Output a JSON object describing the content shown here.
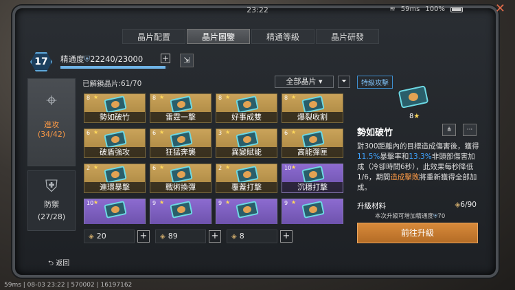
{
  "status": {
    "time": "23:22",
    "ping": "59ms",
    "battery": "100%"
  },
  "tabs": [
    {
      "label": "晶片配置",
      "active": false
    },
    {
      "label": "晶片圖鑒",
      "active": true
    },
    {
      "label": "精通等級",
      "active": false
    },
    {
      "label": "晶片研發",
      "active": false
    }
  ],
  "mastery": {
    "level": "17",
    "label": "精通度",
    "value": "22240/23000",
    "progress": 0.967
  },
  "sidebar": [
    {
      "label": "進攻",
      "count": "(34/42)"
    },
    {
      "label": "防禦",
      "count": "(27/28)"
    }
  ],
  "list": {
    "unlocked": "已解鎖晶片:61/70",
    "filter": "全部晶片"
  },
  "cards": [
    {
      "name": "勢如破竹",
      "count": "8",
      "star": "★",
      "color": "gold"
    },
    {
      "name": "雷霆一擊",
      "count": "8",
      "star": "★",
      "color": "gold"
    },
    {
      "name": "好事成雙",
      "count": "8",
      "star": "★",
      "color": "gold"
    },
    {
      "name": "爆裂收割",
      "count": "8",
      "star": "★",
      "color": "gold"
    },
    {
      "name": "破盾強攻",
      "count": "6",
      "star": "★",
      "color": "gold"
    },
    {
      "name": "狂猛奔襲",
      "count": "6",
      "star": "★",
      "color": "gold"
    },
    {
      "name": "異變賦能",
      "count": "3",
      "star": "★",
      "color": "gold"
    },
    {
      "name": "高能彈匣",
      "count": "6",
      "star": "★",
      "color": "gold"
    },
    {
      "name": "連環暴擊",
      "count": "2",
      "star": "★",
      "color": "gold"
    },
    {
      "name": "戰術換彈",
      "count": "6",
      "star": "★",
      "color": "gold"
    },
    {
      "name": "覆蓋打擊",
      "count": "2",
      "star": "★",
      "color": "gold"
    },
    {
      "name": "沉穩打擊",
      "count": "10",
      "star": "★",
      "color": "purple"
    },
    {
      "name": "",
      "count": "10",
      "star": "★",
      "color": "purple"
    },
    {
      "name": "",
      "count": "9",
      "star": "★",
      "color": "purple"
    },
    {
      "name": "",
      "count": "9",
      "star": "★",
      "color": "purple"
    },
    {
      "name": "",
      "count": "9",
      "star": "★",
      "color": "purple"
    }
  ],
  "resources": [
    {
      "value": "20"
    },
    {
      "value": "89"
    },
    {
      "value": "8"
    }
  ],
  "detail": {
    "type": "特級攻擊",
    "stars": "8",
    "star": "★",
    "name": "勢如破竹",
    "desc_1": "對300距離內的目標造成傷害後，獲得",
    "desc_2": "11.5%",
    "desc_3": "暴擊率和",
    "desc_4": "13.3%",
    "desc_5": "非頭部傷害加成（冷卻時間6秒），此效果每秒降低1/6，期間",
    "desc_6": "造成擊敗",
    "desc_7": "將重新獲得全部加成。",
    "upg_label": "升級材料",
    "upg_value": "6/90",
    "upg_note": "本次升級可增加精通度",
    "upg_note_value": "70",
    "upg_button": "前往升級"
  },
  "back": "返回",
  "footer": "59ms | 08-03 23:22 | 570002 | 16197162"
}
